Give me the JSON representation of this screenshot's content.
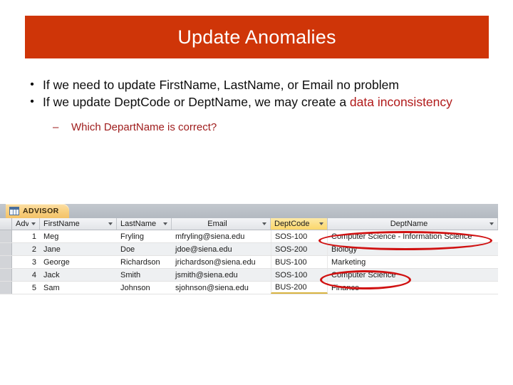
{
  "slide": {
    "title": "Update Anomalies",
    "title_bg": "#cf3508",
    "title_color": "#ffffff",
    "accent_red": "#b11a1a",
    "annotation_red": "#d01111"
  },
  "bullets": [
    {
      "marker": "•",
      "text_plain": "If we need to update FirstName, LastName, or Email no problem",
      "part1": "If we need to update FirstName, LastName, or Email no problem",
      "highlight": ""
    },
    {
      "marker": "•",
      "text_plain": "If we update DeptCode or DeptName, we may create a data inconsistency",
      "part1": "If we update DeptCode or DeptName, we may create a ",
      "highlight": "data inconsistency"
    }
  ],
  "sub_bullet": {
    "marker": "–",
    "text": "Which DepartName is correct?"
  },
  "access": {
    "tab": {
      "label": "ADVISOR",
      "icon": "table-grid-icon"
    },
    "columns": [
      {
        "key": "advisor_id",
        "label": "AdvisorID",
        "has_arrow": true,
        "selected": false
      },
      {
        "key": "first_name",
        "label": "FirstName",
        "has_arrow": true,
        "selected": false
      },
      {
        "key": "last_name",
        "label": "LastName",
        "has_arrow": true,
        "selected": false
      },
      {
        "key": "email",
        "label": "Email",
        "has_arrow": true,
        "selected": false
      },
      {
        "key": "dept_code",
        "label": "DeptCode",
        "has_arrow": true,
        "selected": true
      },
      {
        "key": "dept_name",
        "label": "DeptName",
        "has_arrow": true,
        "selected": false
      }
    ],
    "rows": [
      {
        "advisor_id": "1",
        "first_name": "Meg",
        "last_name": "Fryling",
        "email": "mfryling@siena.edu",
        "dept_code": "SOS-100",
        "dept_name": "Computer Science - Information Science"
      },
      {
        "advisor_id": "2",
        "first_name": "Jane",
        "last_name": "Doe",
        "email": "jdoe@siena.edu",
        "dept_code": "SOS-200",
        "dept_name": "Biology"
      },
      {
        "advisor_id": "3",
        "first_name": "George",
        "last_name": "Richardson",
        "email": "jrichardson@siena.edu",
        "dept_code": "BUS-100",
        "dept_name": "Marketing"
      },
      {
        "advisor_id": "4",
        "first_name": "Jack",
        "last_name": "Smith",
        "email": "jsmith@siena.edu",
        "dept_code": "SOS-100",
        "dept_name": "Computer Science"
      },
      {
        "advisor_id": "5",
        "first_name": "Sam",
        "last_name": "Johnson",
        "email": "sjohnson@siena.edu",
        "dept_code": "BUS-200",
        "dept_name": "Finance"
      }
    ],
    "annotations": [
      {
        "name": "ellipse-row1-deptname",
        "target": "Computer Science - Information Science"
      },
      {
        "name": "ellipse-row4-deptname",
        "target": "Computer Science"
      }
    ]
  }
}
